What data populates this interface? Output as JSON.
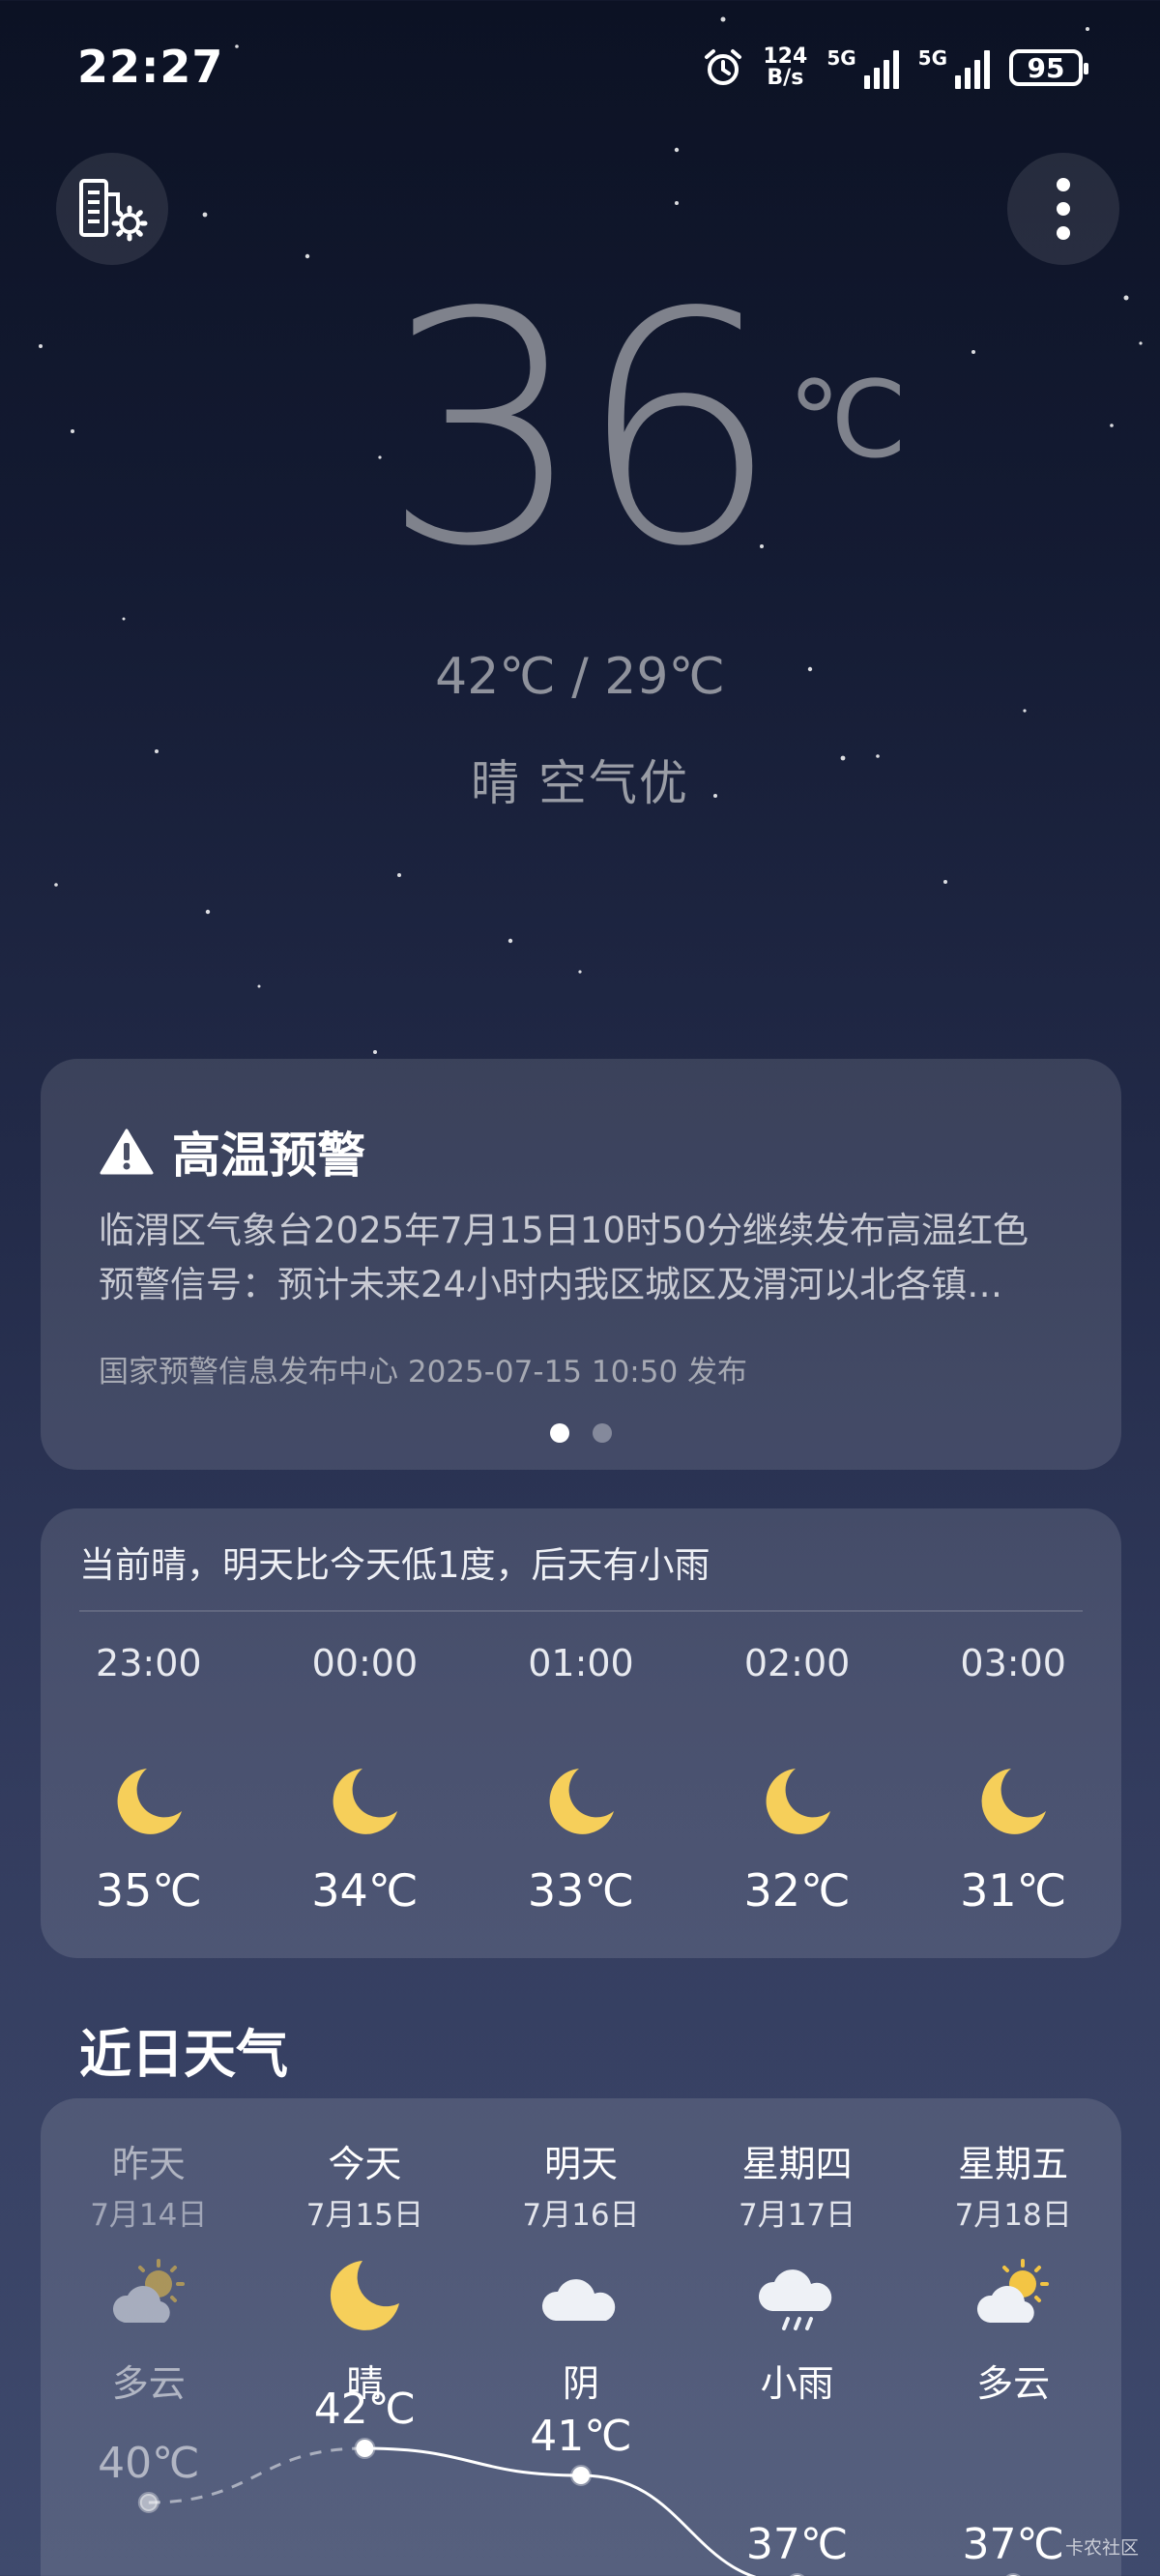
{
  "status_bar": {
    "time": "22:27",
    "speed_value": "124",
    "speed_unit": "B/s",
    "net1": "5G",
    "net2": "5G",
    "battery": "95"
  },
  "current": {
    "temperature": "36",
    "unit": "℃",
    "range": "42℃ / 29℃",
    "condition": "晴 空气优"
  },
  "alert": {
    "title": "高温预警",
    "text_line1": "临渭区气象台2025年7月15日10时50分继续发布高温红色",
    "text_line2": "预警信号：预计未来24小时内我区城区及渭河以北各镇…",
    "source": "国家预警信息发布中心 2025-07-15 10:50 发布",
    "pages": 2,
    "active_page": 1
  },
  "hourly": {
    "summary": "当前晴，明天比今天低1度，后天有小雨",
    "items": [
      {
        "time": "23:00",
        "icon": "moon-icon",
        "temp": "35℃"
      },
      {
        "time": "00:00",
        "icon": "moon-icon",
        "temp": "34℃"
      },
      {
        "time": "01:00",
        "icon": "moon-icon",
        "temp": "33℃"
      },
      {
        "time": "02:00",
        "icon": "moon-icon",
        "temp": "32℃"
      },
      {
        "time": "03:00",
        "icon": "moon-icon",
        "temp": "31℃"
      }
    ]
  },
  "daily": {
    "title": "近日天气",
    "items": [
      {
        "name": "昨天",
        "date": "7月14日",
        "icon": "partly-cloudy-icon",
        "condition": "多云",
        "high": "40℃",
        "high_value": 40
      },
      {
        "name": "今天",
        "date": "7月15日",
        "icon": "moon-icon",
        "condition": "晴",
        "high": "42℃",
        "high_value": 42
      },
      {
        "name": "明天",
        "date": "7月16日",
        "icon": "cloud-icon",
        "condition": "阴",
        "high": "41℃",
        "high_value": 41
      },
      {
        "name": "星期四",
        "date": "7月17日",
        "icon": "light-rain-icon",
        "condition": "小雨",
        "high": "37℃",
        "high_value": 37
      },
      {
        "name": "星期五",
        "date": "7月18日",
        "icon": "partly-cloudy-icon",
        "condition": "多云",
        "high": "37℃",
        "high_value": 37
      }
    ]
  },
  "watermark": "卡农社区",
  "colors": {
    "moon": "#f6cf5a",
    "sun": "#f3c544",
    "cloud": "#eef1f6"
  }
}
